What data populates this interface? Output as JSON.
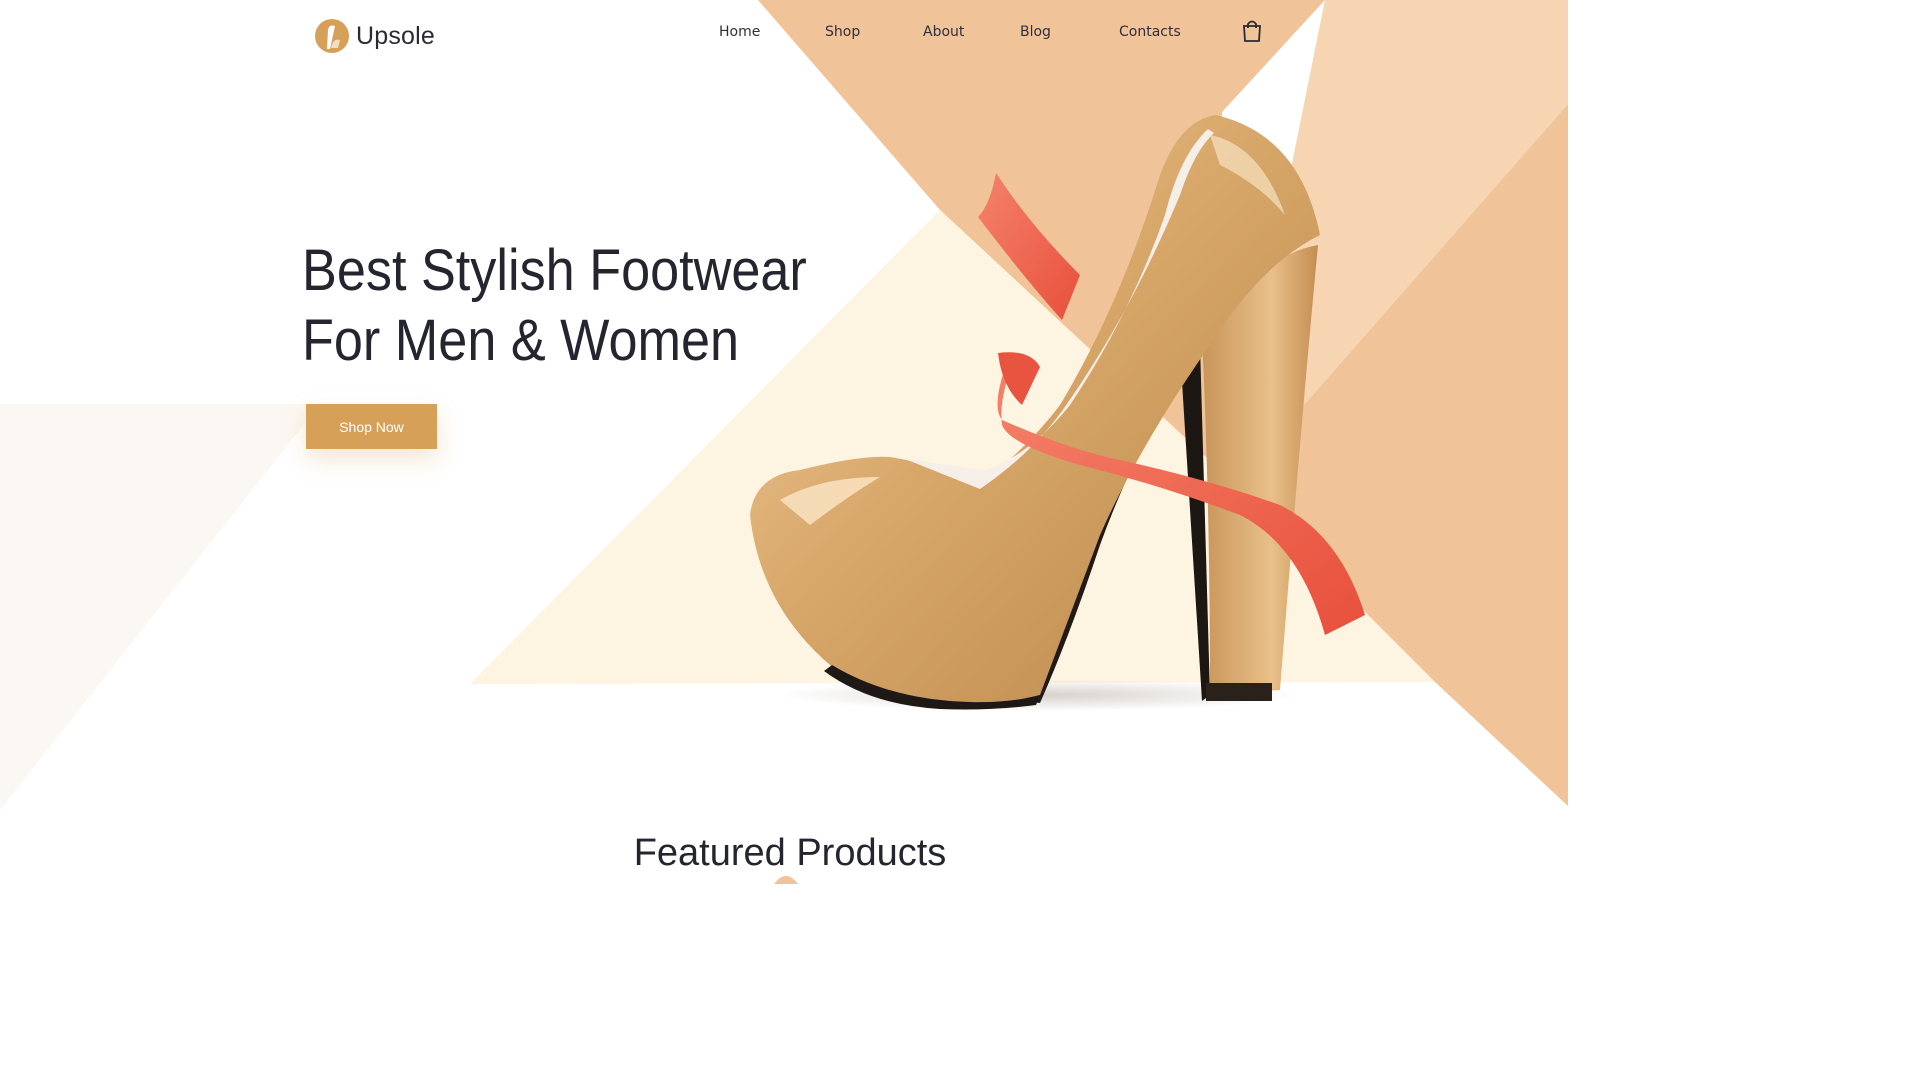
{
  "brand": {
    "name": "Upsole",
    "logo_icon": "high-heel-logo-icon"
  },
  "nav": {
    "items": [
      {
        "label": "Home"
      },
      {
        "label": "Shop"
      },
      {
        "label": "About"
      },
      {
        "label": "Blog"
      },
      {
        "label": "Contacts"
      }
    ],
    "cart_icon": "shopping-bag-icon"
  },
  "hero": {
    "headline_line1": "Best Stylish Footwear",
    "headline_line2": "For Men & Women",
    "cta_label": "Shop Now",
    "image": "gold-high-heel-with-red-ribbon"
  },
  "featured": {
    "title": "Featured Products"
  },
  "colors": {
    "accent": "#d7a058",
    "peach_dark": "#f0c498",
    "peach_light": "#f8d5b2",
    "cream": "#fdf5e2",
    "ribbon": "#f0604a",
    "text": "#25252f"
  }
}
